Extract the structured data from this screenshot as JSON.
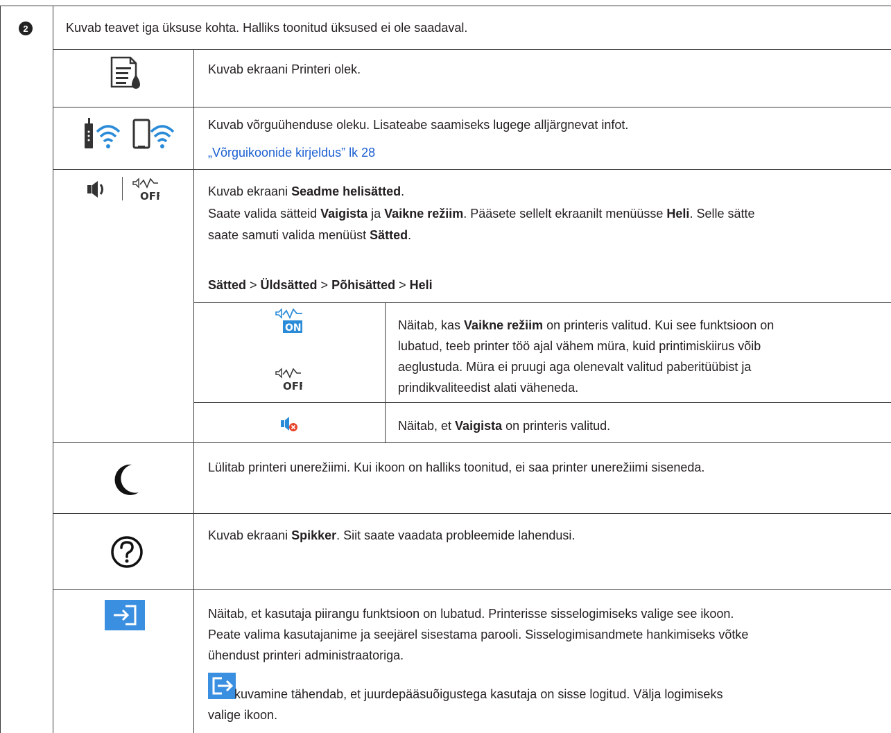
{
  "number_badge": "2",
  "intro": "Kuvab teavet iga üksuse kohta. Halliks toonitud üksused ei ole saadaval.",
  "rows": {
    "status": {
      "text": "Kuvab ekraani Printeri olek."
    },
    "network": {
      "text": "Kuvab võrguühenduse oleku. Lisateabe saamiseks lugege alljärgnevat infot.",
      "link": "„Võrguikoonide kirjeldus” lk 28"
    },
    "sound": {
      "p1_a": "Kuvab ekraani ",
      "p1_b": "Seadme helisätted",
      "p1_c": ".",
      "p2_a": "Saate valida sätteid ",
      "p2_b": "Vaigista",
      "p2_c": " ja ",
      "p2_d": "Vaikne režiim",
      "p2_e": ". Pääsete sellelt ekraanilt menüüsse ",
      "p2_f": "Heli",
      "p2_g": ". Selle sätte",
      "p2_h": "saate samuti valida menüüst ",
      "p2_i": "Sätted",
      "p2_j": ".",
      "path_1": "Sätted",
      "path_sep": " > ",
      "path_2": "Üldsätted",
      "path_3": "Põhisätted",
      "path_4": "Heli",
      "quiet_a": "Näitab, kas ",
      "quiet_b": "Vaikne režiim",
      "quiet_c": " on printeris valitud. Kui see funktsioon on",
      "quiet_l2": "lubatud, teeb printer töö ajal vähem müra, kuid printimiskiirus võib",
      "quiet_l3": "aeglustuda. Müra ei pruugi aga olenevalt valitud paberitüübist ja",
      "quiet_l4": "prindikvaliteedist alati väheneda.",
      "mute_a": "Näitab, et ",
      "mute_b": "Vaigista",
      "mute_c": " on printeris valitud.",
      "on_label": "ON",
      "off_label": "OFF"
    },
    "sleep": {
      "text": "Lülitab printeri unerežiimi. Kui ikoon on halliks toonitud, ei saa printer unerežiimi siseneda."
    },
    "help": {
      "text_a": "Kuvab ekraani ",
      "text_b": "Spikker",
      "text_c": ". Siit saate vaadata probleemide lahendusi."
    },
    "login": {
      "l1": "Näitab, et kasutaja piirangu funktsioon on lubatud. Printerisse sisselogimiseks valige see ikoon.",
      "l2": "Peate valima kasutajanime ja seejärel sisestama parooli. Sisselogimisandmete hankimiseks võtke",
      "l3": "ühendust printeri administraatoriga.",
      "l4": " kuvamine tähendab, et juurdepääsuõigustega kasutaja on sisse logitud. Välja logimiseks",
      "l5": "valige ikoon."
    }
  },
  "colors": {
    "blue": "#2a8bd8",
    "link": "#1a5fd0",
    "line": "#3a3a3a"
  }
}
